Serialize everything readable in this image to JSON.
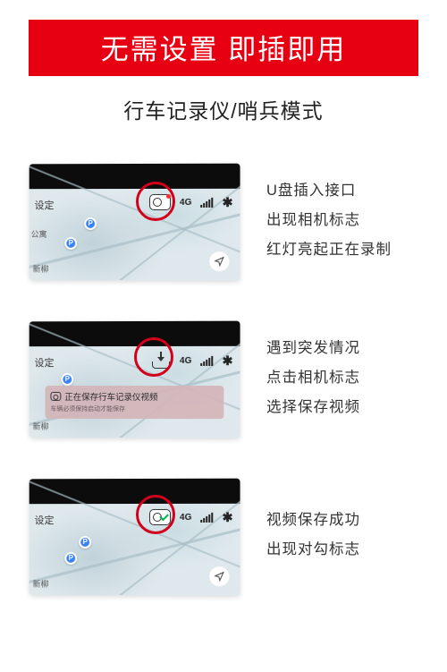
{
  "banner": {
    "text": "无需设置 即插即用",
    "bg": "#e60012",
    "fg": "#ffffff"
  },
  "subtitle": "行车记录仪/哨兵模式",
  "screenshot_labels": {
    "settings": "设定",
    "fourg": "4G",
    "map_text_1": "新柳",
    "map_text_2": "公寓"
  },
  "toast": {
    "main": "正在保存行车记录仪视频",
    "sub": "车辆必须保持启动才能保存"
  },
  "rows": [
    {
      "icon_state": "recording",
      "lines": [
        "U盘插入接口",
        "出现相机标志",
        "红灯亮起正在录制"
      ]
    },
    {
      "icon_state": "saving",
      "lines": [
        "遇到突发情况",
        "点击相机标志",
        "选择保存视频"
      ]
    },
    {
      "icon_state": "saved_ok",
      "lines": [
        "视频保存成功",
        "出现对勾标志"
      ]
    }
  ]
}
